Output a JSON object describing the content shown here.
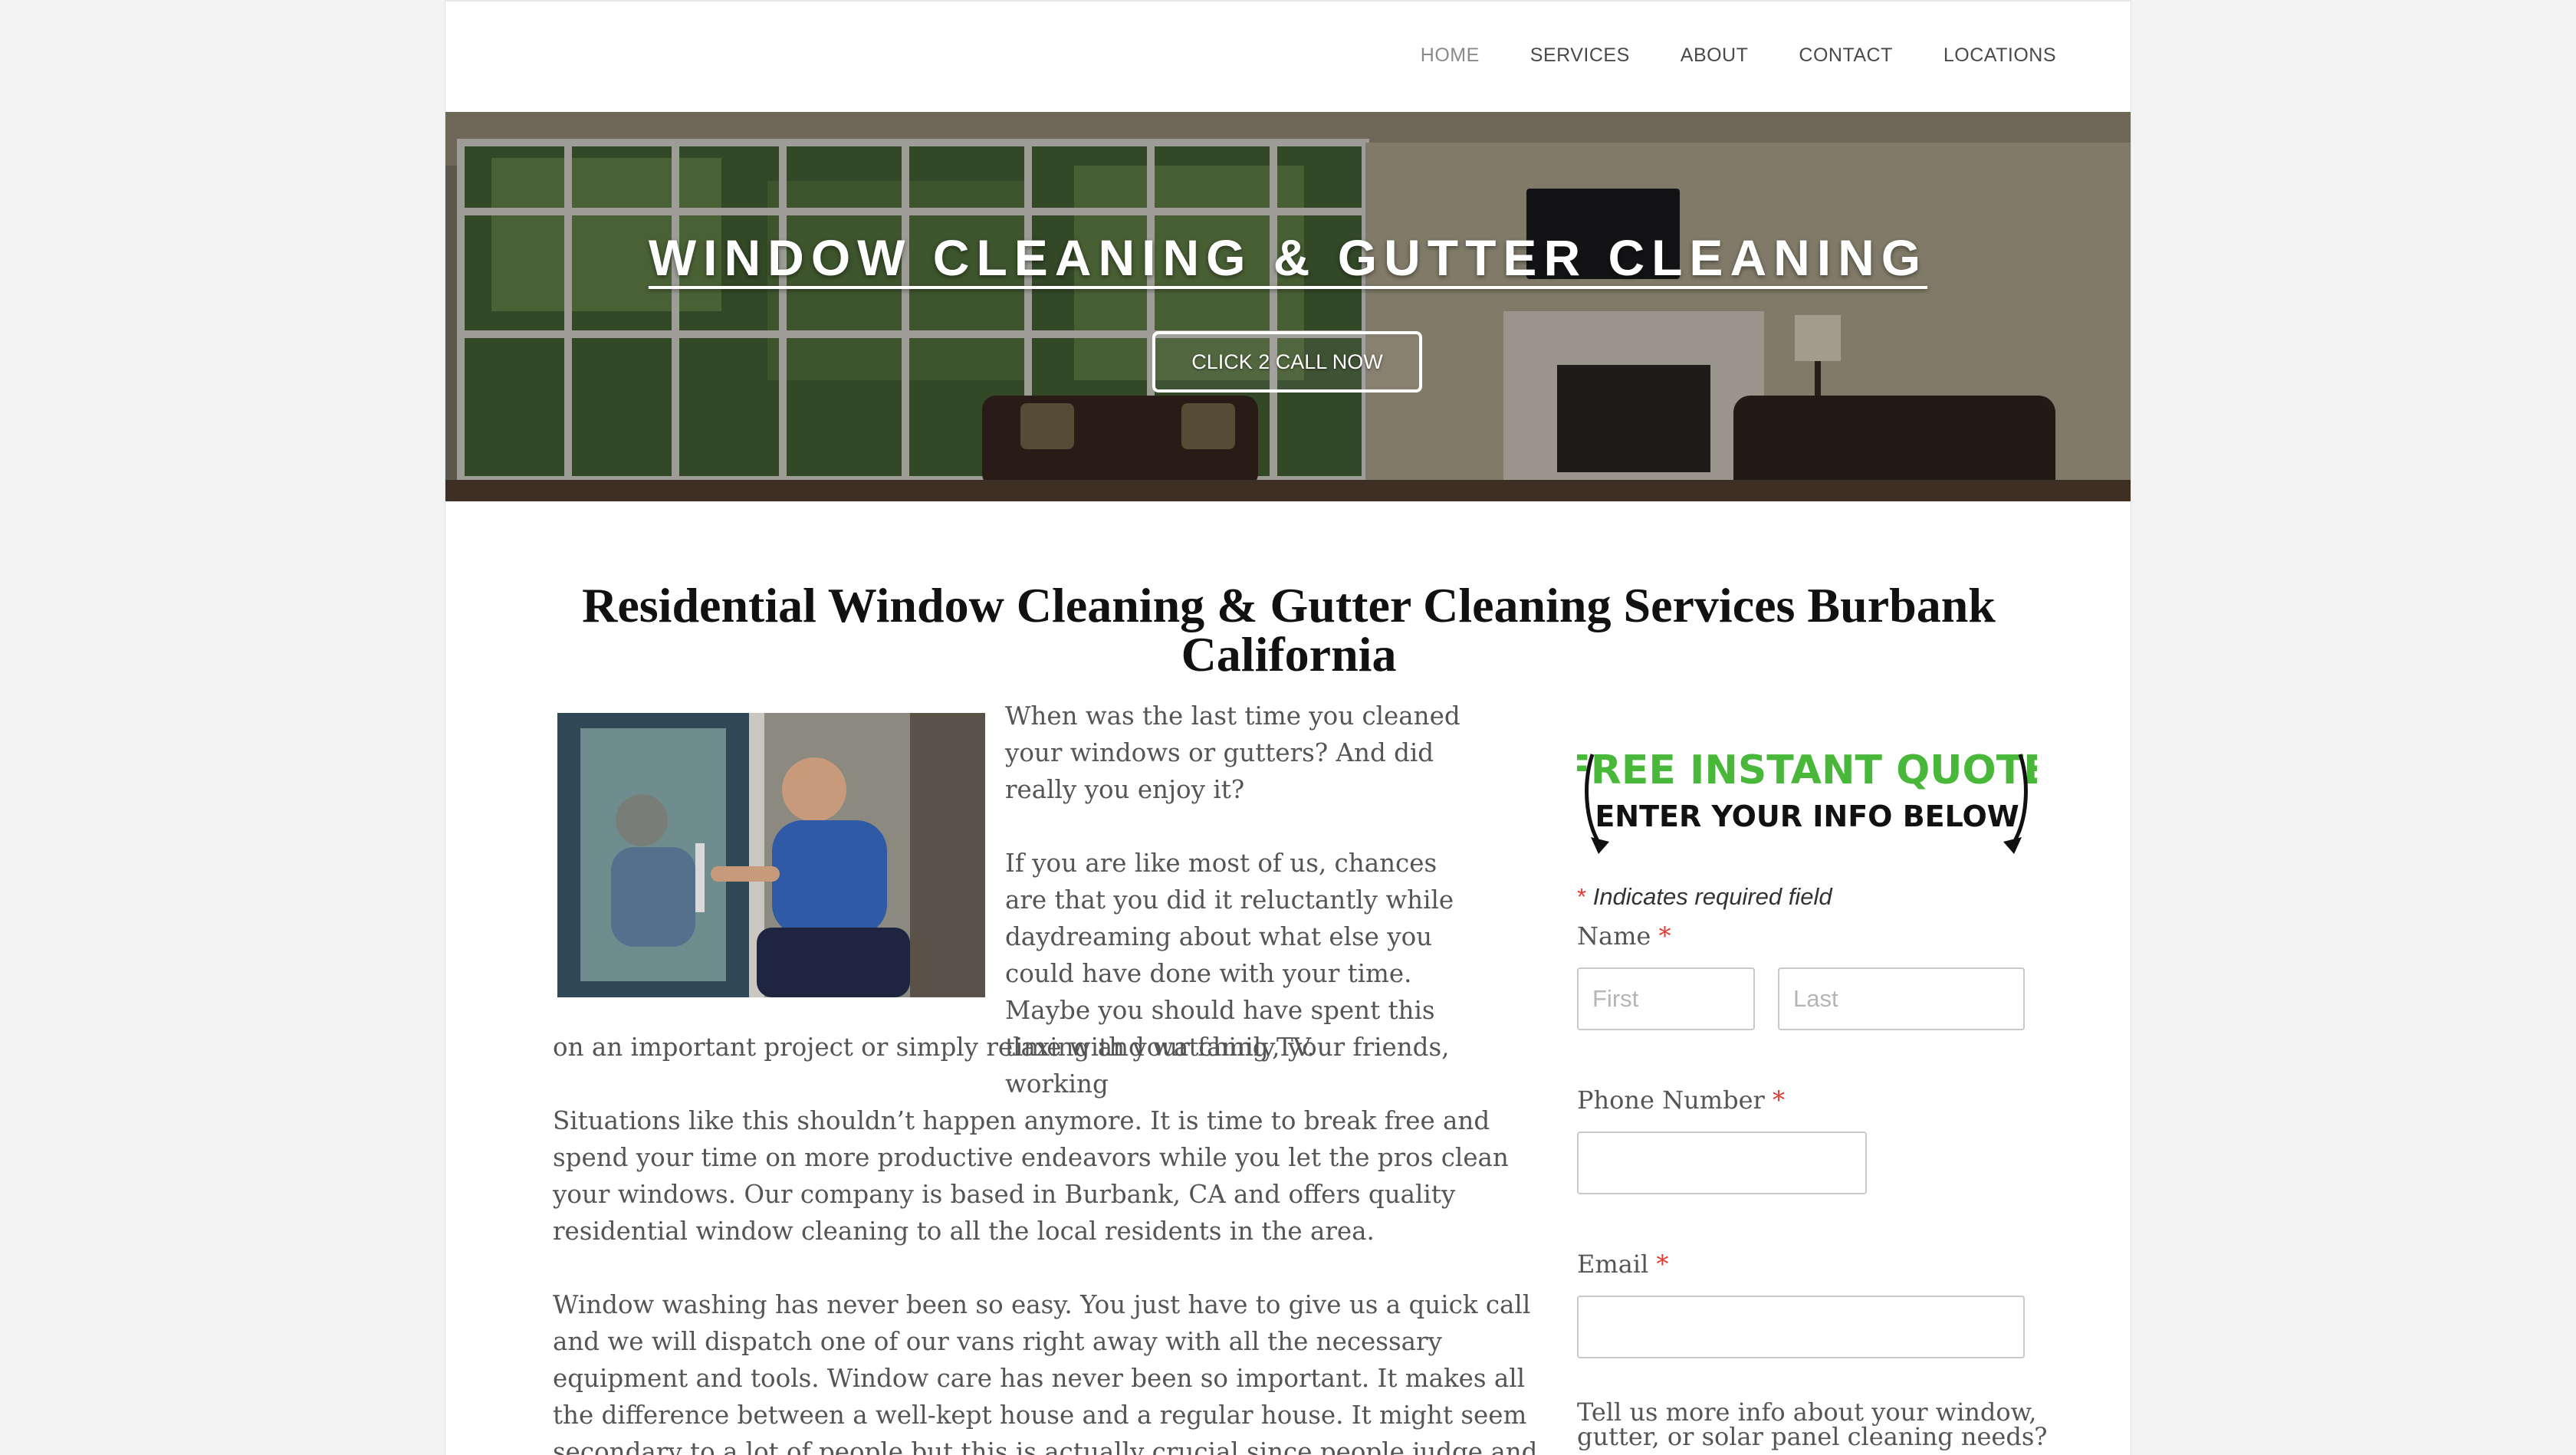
{
  "nav": {
    "items": [
      {
        "label": "HOME"
      },
      {
        "label": "SERVICES"
      },
      {
        "label": "ABOUT"
      },
      {
        "label": "CONTACT"
      },
      {
        "label": "LOCATIONS"
      }
    ]
  },
  "hero": {
    "title": "WINDOW CLEANING & GUTTER CLEANING",
    "cta_label": "CLICK 2 CALL NOW"
  },
  "main": {
    "heading": "Residential Window Cleaning & Gutter Cleaning Services Burbank California",
    "p1": "When was the last time you cleaned your windows or gutters? And did really you enjoy it?",
    "p2": "If you are like most of us, chances are that you did it reluctantly while daydreaming about what else you could have done with your time. Maybe you should have spent this time with your family, your friends, working",
    "p2_cont": "on an important project or simply relaxing and watching TV.",
    "p3": "Situations like this shouldn’t happen anymore. It is time to break free and spend your time on more productive endeavors while you let the pros clean your windows. Our company is based in Burbank, CA and offers quality residential window cleaning to all the local residents in the area.",
    "p4": "Window washing has never been so easy. You just have to give us a quick call and we will dispatch one of our vans right away with all the necessary equipment and tools. Window care has never been so important. It makes all the difference between a well-kept house and a regular house. It might seem secondary to a lot of people but this is actually crucial since people judge and pay attention to details."
  },
  "form": {
    "banner_line1": "FREE INSTANT QUOTE",
    "banner_line2": "ENTER YOUR INFO BELOW",
    "required_star": "*",
    "required_note": "Indicates required field",
    "name_label": "Name",
    "first_placeholder": "First",
    "last_placeholder": "Last",
    "phone_label": "Phone Number",
    "email_label": "Email",
    "more_info_label": "Tell us more info about your window, gutter, or solar panel cleaning needs?"
  },
  "colors": {
    "banner_green": "#49b83a",
    "required_red": "#e53935"
  }
}
